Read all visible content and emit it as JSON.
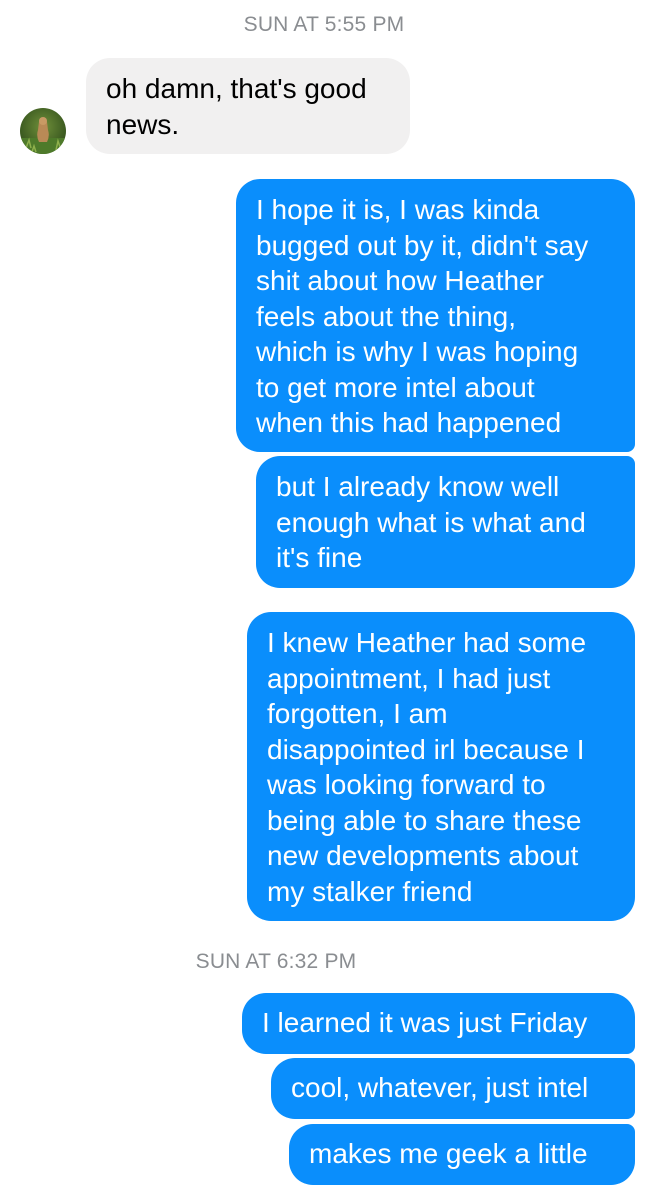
{
  "conversation": {
    "timestamps": [
      "SUN AT 5:55 PM",
      "SUN AT 6:32 PM"
    ],
    "messages": [
      {
        "sender": "them",
        "text": "oh damn, that's good\nnews."
      },
      {
        "sender": "me",
        "text": "I hope it is, I was kinda\nbugged out by it, didn't say\nshit about how Heather\nfeels about the thing,\nwhich is why I was hoping\nto get more intel about\nwhen this had happened"
      },
      {
        "sender": "me",
        "text": "but I already know well\nenough what is what and\nit's fine"
      },
      {
        "sender": "me",
        "text": "I knew Heather had some\nappointment, I had just\nforgotten, I am\ndisappointed irl because I\nwas looking forward to\nbeing able to share these\nnew developments about\nmy stalker friend"
      },
      {
        "sender": "me",
        "text": "I learned it was just Friday"
      },
      {
        "sender": "me",
        "text": "cool, whatever, just intel"
      },
      {
        "sender": "me",
        "text": "makes me geek a little"
      }
    ]
  },
  "colors": {
    "outgoing_bubble": "#0a8efc",
    "incoming_bubble": "#f1f0f0",
    "timestamp_text": "#8a8d91"
  },
  "icons": {
    "contact_avatar": "avatar-photo-icon"
  }
}
